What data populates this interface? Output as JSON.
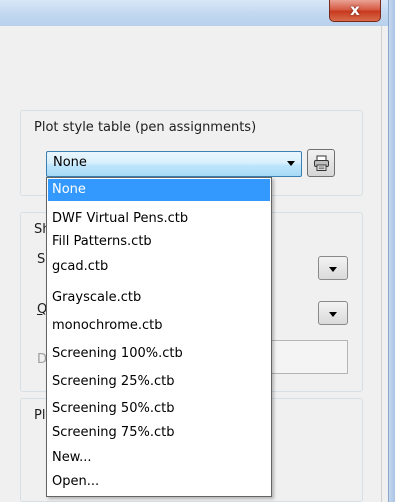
{
  "window": {
    "close_label": "x"
  },
  "plot_style": {
    "group_label": "Plot style table (pen assignments)",
    "selected": "None",
    "options": [
      "None",
      "DWF Virtual Pens.ctb",
      "Fill Patterns.ctb",
      "gcad.ctb",
      "Grayscale.ctb",
      "monochrome.ctb",
      "Screening 100%.ctb",
      "Screening 25%.ctb",
      "Screening 50%.ctb",
      "Screening 75%.ctb",
      "New...",
      "Open..."
    ],
    "edit_icon": "printer-icon"
  },
  "partial": {
    "group2_label_stub": "Sh",
    "row1_label_stub": "S",
    "row2_label_stub": "Q",
    "row3_label_stub": "D",
    "group3_label_stub": "Pl"
  },
  "colors": {
    "selection": "#3399ff",
    "combo_active_border": "#3c7fb1",
    "close_button": "#c7381d"
  }
}
